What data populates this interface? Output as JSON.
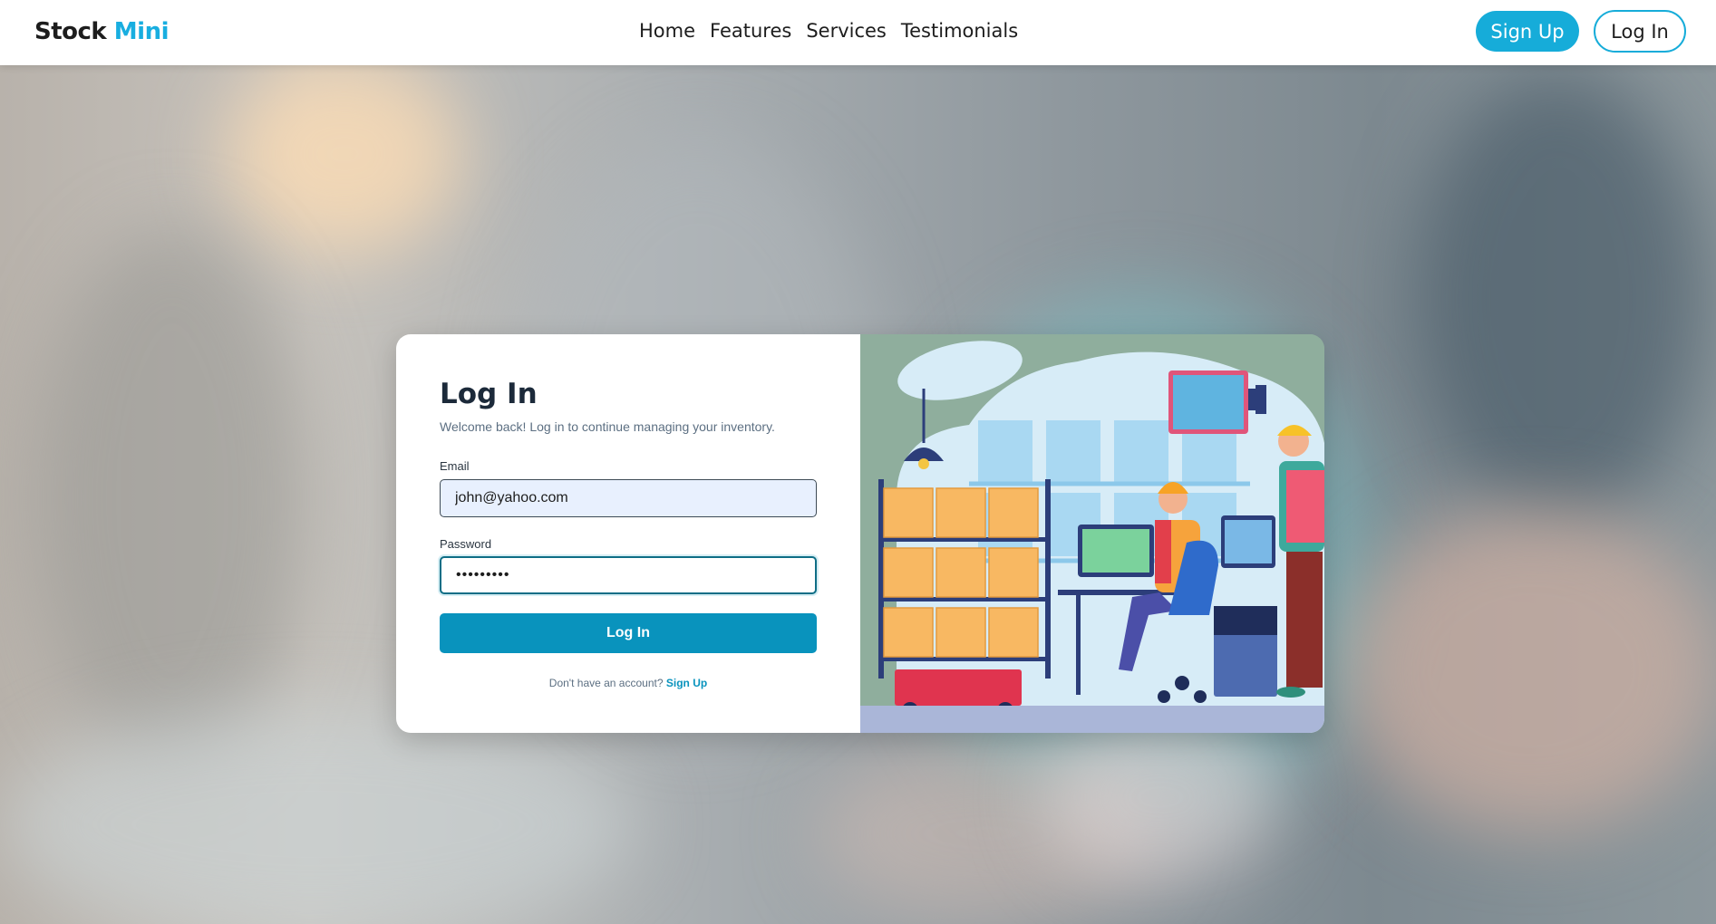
{
  "brand": {
    "name": "Stock",
    "accent": "Mini",
    "accent_color": "#18aee0"
  },
  "nav": {
    "links": [
      "Home",
      "Features",
      "Services",
      "Testimonials"
    ],
    "signup_label": "Sign Up",
    "login_label": "Log In"
  },
  "login_form": {
    "title": "Log In",
    "subtitle": "Welcome back! Log in to continue managing your inventory.",
    "email_label": "Email",
    "email_value": "john@yahoo.com",
    "password_label": "Password",
    "password_value": "•••••••••",
    "submit_label": "Log In",
    "footer_prompt": "Don't have an account?",
    "footer_link": "Sign Up"
  },
  "illustration": {
    "name": "warehouse-workers-illustration"
  },
  "colors": {
    "primary": "#0993bd",
    "nav_accent": "#16acd9",
    "title": "#1c2a3a"
  }
}
